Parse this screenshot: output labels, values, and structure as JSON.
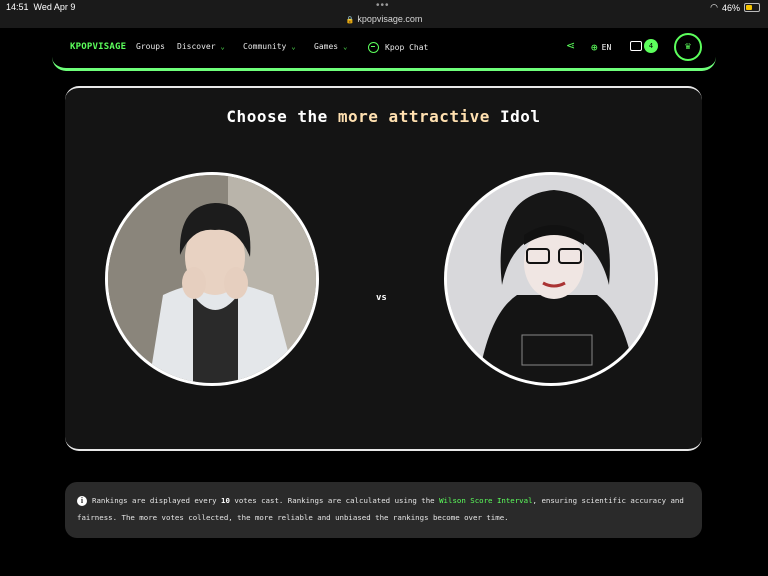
{
  "status_bar": {
    "time": "14:51",
    "date": "Wed Apr 9",
    "dots": "•••",
    "url": "kpopvisage.com",
    "battery": "46%"
  },
  "nav": {
    "logo_a": "KPOP",
    "logo_b": "VISAGE",
    "items": [
      {
        "label": "Groups"
      },
      {
        "label": "Discover"
      },
      {
        "label": "Community"
      },
      {
        "label": "Games"
      },
      {
        "label": "Kpop Chat"
      }
    ],
    "lang": "EN",
    "inbox_count": "4",
    "accent": "#5cff5c"
  },
  "vote": {
    "title_pre": "Choose the ",
    "title_hl": "more attractive",
    "title_post": " Idol",
    "vs": "vs"
  },
  "info": {
    "text_1": "Rankings are displayed every ",
    "count": "10",
    "text_2": " votes cast. Rankings are calculated using the ",
    "link": "Wilson Score Interval",
    "text_3": ", ensuring scientific accuracy and fairness. The more votes collected, the more reliable and unbiased the rankings become over time."
  }
}
